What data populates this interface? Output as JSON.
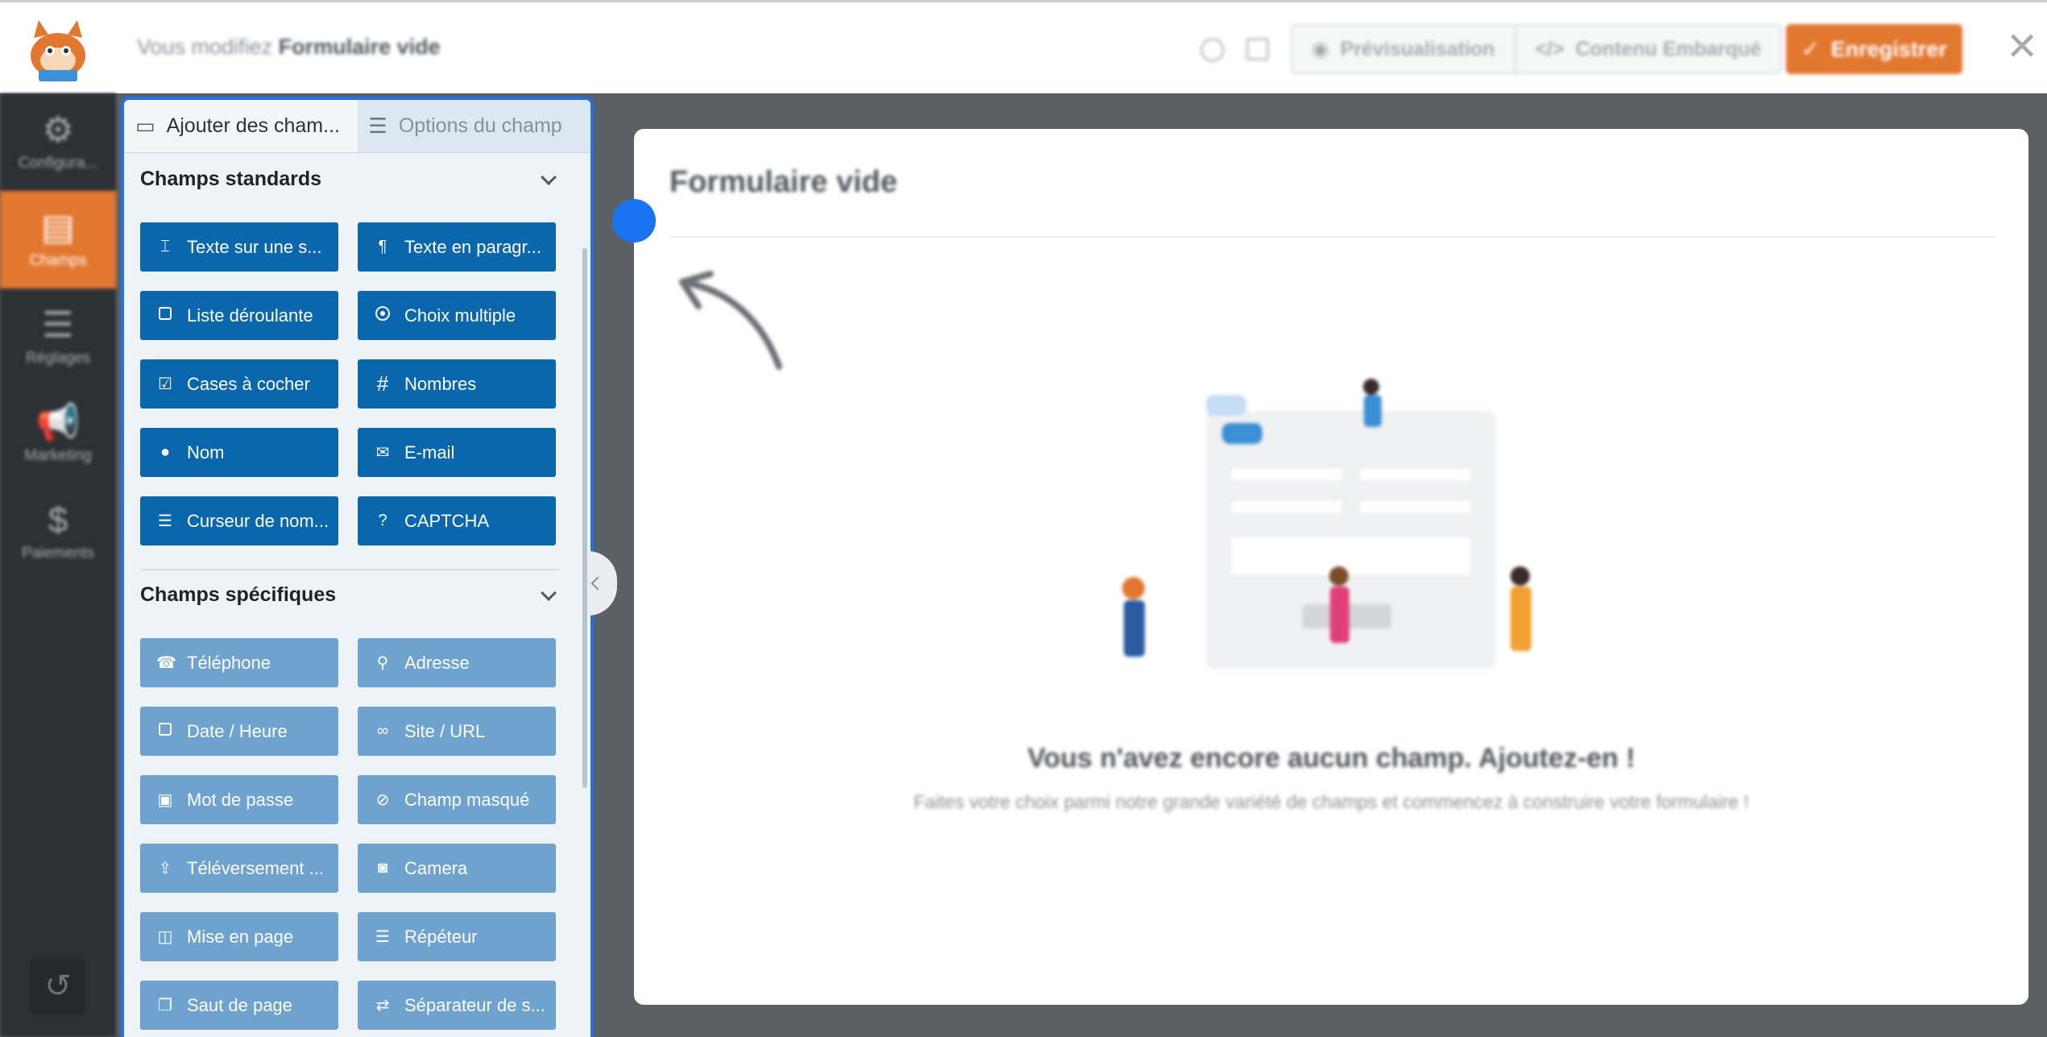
{
  "topbar": {
    "editing_prefix": "Vous modifiez",
    "form_name": "Formulaire vide",
    "preview_label": "Prévisualisation",
    "embed_label": "Contenu Embarqué",
    "save_label": "Enregistrer",
    "close_symbol": "✕"
  },
  "nav": {
    "items": [
      {
        "label": "Configura...",
        "icon": "gear-icon"
      },
      {
        "label": "Champs",
        "icon": "fields-icon"
      },
      {
        "label": "Réglages",
        "icon": "sliders-icon"
      },
      {
        "label": "Marketing",
        "icon": "megaphone-icon"
      },
      {
        "label": "Paiements",
        "icon": "dollar-icon"
      }
    ],
    "active": "Champs"
  },
  "panel": {
    "tabs": [
      {
        "label": "Ajouter des cham...",
        "active": true
      },
      {
        "label": "Options du champ",
        "active": false
      }
    ],
    "standard": {
      "title": "Champs standards",
      "fields": [
        {
          "label": "Texte sur une s...",
          "icon": "text-cursor-icon"
        },
        {
          "label": "Texte en paragr...",
          "icon": "paragraph-icon"
        },
        {
          "label": "Liste déroulante",
          "icon": "dropdown-icon"
        },
        {
          "label": "Choix multiple",
          "icon": "radio-icon"
        },
        {
          "label": "Cases à cocher",
          "icon": "checkbox-icon"
        },
        {
          "label": "Nombres",
          "icon": "hash-icon"
        },
        {
          "label": "Nom",
          "icon": "user-icon"
        },
        {
          "label": "E-mail",
          "icon": "envelope-icon"
        },
        {
          "label": "Curseur de nom...",
          "icon": "sliders-icon"
        },
        {
          "label": "CAPTCHA",
          "icon": "question-circle-icon"
        }
      ]
    },
    "specific": {
      "title": "Champs spécifiques",
      "fields": [
        {
          "label": "Téléphone",
          "icon": "phone-icon"
        },
        {
          "label": "Adresse",
          "icon": "map-pin-icon"
        },
        {
          "label": "Date / Heure",
          "icon": "calendar-icon"
        },
        {
          "label": "Site / URL",
          "icon": "link-icon"
        },
        {
          "label": "Mot de passe",
          "icon": "lock-icon"
        },
        {
          "label": "Champ masqué",
          "icon": "eye-slash-icon"
        },
        {
          "label": "Téléversement ...",
          "icon": "upload-icon"
        },
        {
          "label": "Camera",
          "icon": "camera-icon"
        },
        {
          "label": "Mise en page",
          "icon": "layout-icon"
        },
        {
          "label": "Répéteur",
          "icon": "list-icon"
        },
        {
          "label": "Saut de page",
          "icon": "copy-icon"
        },
        {
          "label": "Séparateur de s...",
          "icon": "arrows-icon"
        }
      ]
    }
  },
  "canvas": {
    "form_title": "Formulaire vide",
    "empty_title": "Vous n'avez encore aucun champ. Ajoutez-en !",
    "empty_subtitle": "Faites votre choix parmi notre grande variété de champs et commencez à construire votre formulaire !"
  },
  "colors": {
    "accent": "#e27730",
    "standard_button": "#0b67ad",
    "specific_button": "#6fa3cf",
    "panel_border": "#2271e6",
    "nav_background": "#2d3136"
  }
}
